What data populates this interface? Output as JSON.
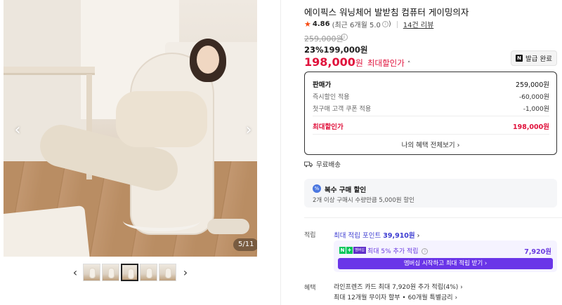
{
  "gallery": {
    "counter": "5/11",
    "prev_arrow": "‹",
    "next_arrow": "›",
    "thumb_prev": "‹",
    "thumb_next": "›",
    "thumb_count": 5,
    "active_thumb_index": 2
  },
  "product": {
    "title": "에이픽스 워닝체어 발받침 컴퓨터 게이밍의자",
    "rating": "4.86",
    "rating_note": "(최근 6개월 5.0",
    "rating_note_end": ")",
    "review_link": "14건 리뷰",
    "original_price": "259,000원",
    "discount_rate": "23%",
    "discount_price": "199,000원",
    "final_price": "198,000",
    "final_price_unit": "원",
    "final_label": "최대할인가",
    "coupon_button": "발급 완료",
    "coupon_icon": "N"
  },
  "price_breakdown": {
    "rows": [
      {
        "label": "판매가",
        "value": "259,000원"
      },
      {
        "label": "즉시할인 적용",
        "value": "-60,000원"
      },
      {
        "label": "첫구매 고객 쿠폰 적용",
        "value": "-1,000원"
      },
      {
        "label": "최대할인가",
        "value": "198,000원"
      }
    ],
    "benefit_link": "나의 혜택 전체보기 ›"
  },
  "shipping": {
    "label": "무료배송"
  },
  "multi_purchase": {
    "icon": "%",
    "title": "복수 구매 할인",
    "desc": "2개 이상 구매시 수량만큼 5,000원 할인"
  },
  "points": {
    "row_label": "적립",
    "link_prefix": "최대 적립 포인트 ",
    "link_amount": "39,910원",
    "link_chev": " ›",
    "member_title": "최대 5% 추가 적립",
    "member_amount": "7,920원",
    "member_cta": "멤버십 시작하고 최대 적립 받기 ›",
    "badge_n": "N",
    "badge_plus": "+",
    "badge_text": "멤버십"
  },
  "benefits": {
    "row_label": "혜택",
    "line1": "라인프렌즈 카드 최대 7,920원 추가 적립(4%) ›",
    "line2": "최대 12개월 무이자 할부 • 60개월 특별금리 ›"
  },
  "colors": {
    "accent_red": "#e0113b",
    "star": "#f74b12",
    "member_purple": "#6a35e8",
    "naver_green": "#03c75a"
  }
}
